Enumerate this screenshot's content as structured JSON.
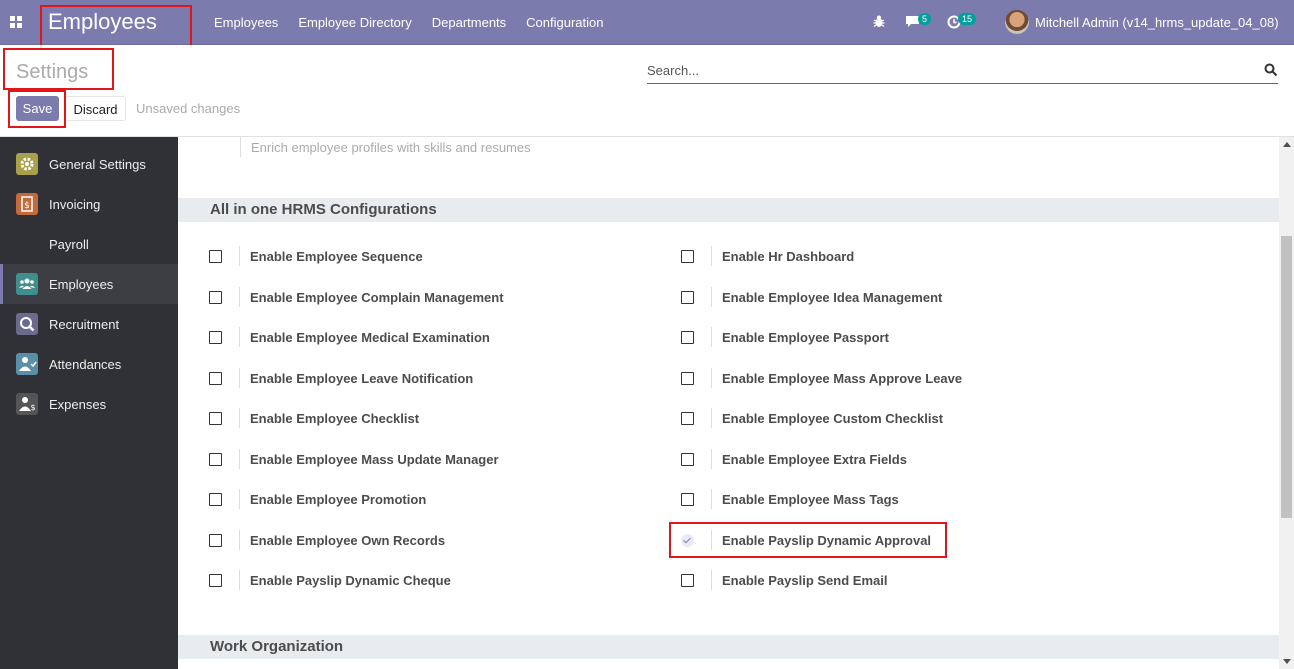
{
  "navbar": {
    "brand": "Employees",
    "menu": [
      "Employees",
      "Employee Directory",
      "Departments",
      "Configuration"
    ],
    "messages_count": "5",
    "activities_count": "15",
    "user": "Mitchell Admin (v14_hrms_update_04_08)"
  },
  "control": {
    "title": "Settings",
    "search_placeholder": "Search...",
    "save_label": "Save",
    "discard_label": "Discard",
    "status": "Unsaved changes"
  },
  "sidebar": {
    "items": [
      {
        "label": "General Settings",
        "icon": "gear-icon",
        "color": "#a8a04a"
      },
      {
        "label": "Invoicing",
        "icon": "invoice-icon",
        "color": "#c36b3a"
      },
      {
        "label": "Payroll",
        "icon": "",
        "color": ""
      },
      {
        "label": "Employees",
        "icon": "users-icon",
        "color": "#3f8f8c"
      },
      {
        "label": "Recruitment",
        "icon": "magnifier-icon",
        "color": "#6c6b8e"
      },
      {
        "label": "Attendances",
        "icon": "person-icon",
        "color": "#5b8fa8"
      },
      {
        "label": "Expenses",
        "icon": "money-icon",
        "color": "#555"
      }
    ],
    "active": "Employees"
  },
  "content": {
    "prev_setting_hint": "Enrich employee profiles with skills and resumes",
    "section_title": "All in one HRMS Configurations",
    "left_options": [
      {
        "label": "Enable Employee Sequence",
        "checked": false
      },
      {
        "label": "Enable Employee Complain Management",
        "checked": false
      },
      {
        "label": "Enable Employee Medical Examination",
        "checked": false
      },
      {
        "label": "Enable Employee Leave Notification",
        "checked": false
      },
      {
        "label": "Enable Employee Checklist",
        "checked": false
      },
      {
        "label": "Enable Employee Mass Update Manager",
        "checked": false
      },
      {
        "label": "Enable Employee Promotion",
        "checked": false
      },
      {
        "label": "Enable Employee Own Records",
        "checked": false
      },
      {
        "label": "Enable Payslip Dynamic Cheque",
        "checked": false
      }
    ],
    "right_options": [
      {
        "label": "Enable Hr Dashboard",
        "checked": false
      },
      {
        "label": "Enable Employee Idea Management",
        "checked": false
      },
      {
        "label": "Enable Employee Passport",
        "checked": false
      },
      {
        "label": "Enable Employee Mass Approve Leave",
        "checked": false
      },
      {
        "label": "Enable Employee Custom Checklist",
        "checked": false
      },
      {
        "label": "Enable Employee Extra Fields",
        "checked": false
      },
      {
        "label": "Enable Employee Mass Tags",
        "checked": false
      },
      {
        "label": "Enable Payslip Dynamic Approval",
        "checked": true
      },
      {
        "label": "Enable Payslip Send Email",
        "checked": false
      }
    ],
    "next_section_title": "Work Organization"
  },
  "colors": {
    "navbar": "#7c7bad",
    "sidebar": "#2f3136",
    "highlight": "#e0161b"
  }
}
